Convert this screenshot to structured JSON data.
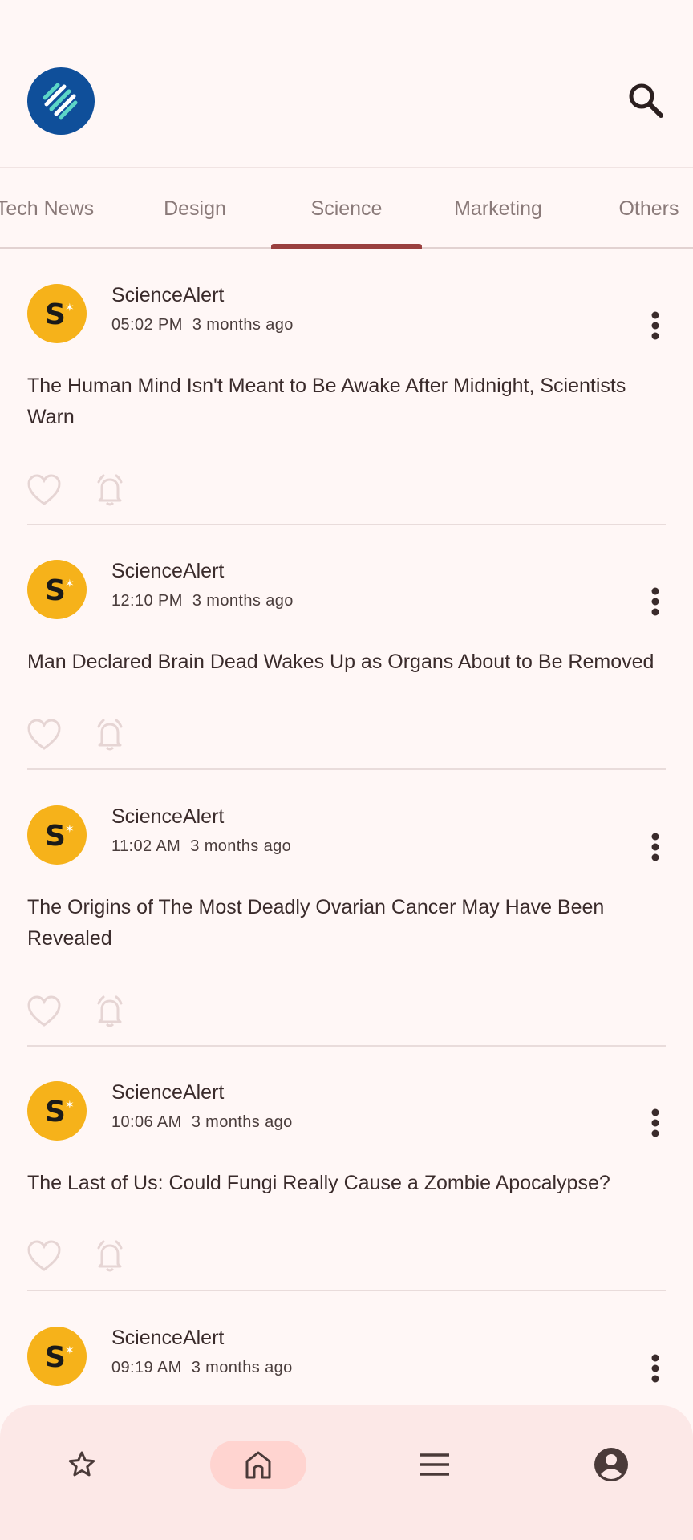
{
  "header": {
    "logo_icon": "feed-app-logo",
    "search_icon": "search-icon"
  },
  "tabs": [
    {
      "label": "Tech News"
    },
    {
      "label": "Design"
    },
    {
      "label": "Science",
      "active": true
    },
    {
      "label": "Marketing"
    },
    {
      "label": "Others"
    }
  ],
  "articles": [
    {
      "source": "ScienceAlert",
      "time": "05:02 PM",
      "ago": "3 months ago",
      "title": "The Human Mind Isn't Meant to Be Awake After Midnight, Scientists Warn"
    },
    {
      "source": "ScienceAlert",
      "time": "12:10 PM",
      "ago": "3 months ago",
      "title": "Man Declared Brain Dead Wakes Up as Organs About to Be Removed"
    },
    {
      "source": "ScienceAlert",
      "time": "11:02 AM",
      "ago": "3 months ago",
      "title": "The Origins of The Most Deadly Ovarian Cancer May Have Been Revealed"
    },
    {
      "source": "ScienceAlert",
      "time": "10:06 AM",
      "ago": "3 months ago",
      "title": "The Last of Us: Could Fungi Really Cause a Zombie Apocalypse?"
    },
    {
      "source": "ScienceAlert",
      "time": "09:19 AM",
      "ago": "3 months ago",
      "title": ""
    }
  ],
  "bottom_nav": [
    {
      "icon": "star-icon"
    },
    {
      "icon": "home-icon",
      "active": true
    },
    {
      "icon": "menu-icon"
    },
    {
      "icon": "account-icon"
    }
  ],
  "colors": {
    "background": "#FFF7F6",
    "accent": "#9A403F",
    "avatar": "#F6B21A",
    "nav_background": "#FCE8E7",
    "nav_active_pill": "#FFD4D0",
    "logo": "#0F4F9A"
  }
}
